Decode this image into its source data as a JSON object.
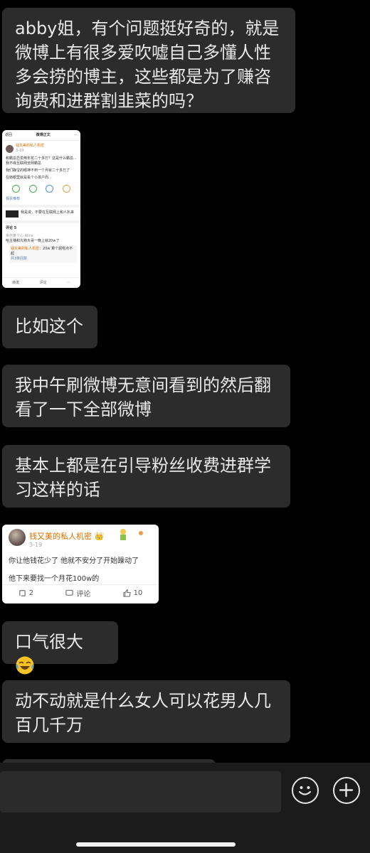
{
  "messages": [
    {
      "type": "text",
      "text": "abby姐，有个问题挺好奇的，就是微博上有很多爱吹嘘自己多懂人性多会捞的博主，这些都是为了赚咨询费和进群割韭菜的吗？"
    },
    {
      "type": "image",
      "screenshot1": {
        "header_back": "返回",
        "header_title": "微博正文",
        "username": "钱又美的私人机密",
        "date": "3-19",
        "line1": "和霸总恋爱两年花二十多万？这是什么霸总...我不缘互联网全网霸总",
        "line2": "我们静宝的眼神不到一个月就二十多万了",
        "line3": "在她眼里就是看个小孩户而...",
        "related": "相关推荐",
        "repost_text": "我是说，不要在互联网上和人扒来",
        "comments_tab": "评论 5",
        "commenter": "来自某个心 Alice",
        "comment_text": "哈主播和丸物大哥一晚上就20w了",
        "reply_user": "钱又美的私人机密",
        "reply_text": "20w 算个屁啦点不起",
        "reply_more": "共3条回复",
        "footer_share": "转发",
        "footer_comment": "评论"
      }
    },
    {
      "type": "text",
      "text": "比如这个"
    },
    {
      "type": "text",
      "text": "我中午刷微博无意间看到的然后翻看了一下全部微博"
    },
    {
      "type": "text",
      "text": "基本上都是在引导粉丝收费进群学习这样的话"
    },
    {
      "type": "image",
      "screenshot2": {
        "username": "钱又美的私人机密",
        "date": "3-19",
        "line1": "你让他钱花少了 他就不安分了开始躁动了",
        "line2": "他下来要找一个月花100w的",
        "repost_count": "2",
        "comment_label": "评论",
        "like_count": "10"
      }
    },
    {
      "type": "text",
      "text": "口气很大"
    },
    {
      "type": "text",
      "text": "动不动就是什么女人可以花男人几百几千万"
    }
  ],
  "icons": {
    "emoji_button": "emoji-icon",
    "add_button": "plus-icon",
    "laugh_cry": "laugh-cry-emoji"
  },
  "colors": {
    "background": "#000000",
    "bubble": "#2c2c2c",
    "text": "#e8e8e8",
    "weibo_name": "#e07000"
  }
}
